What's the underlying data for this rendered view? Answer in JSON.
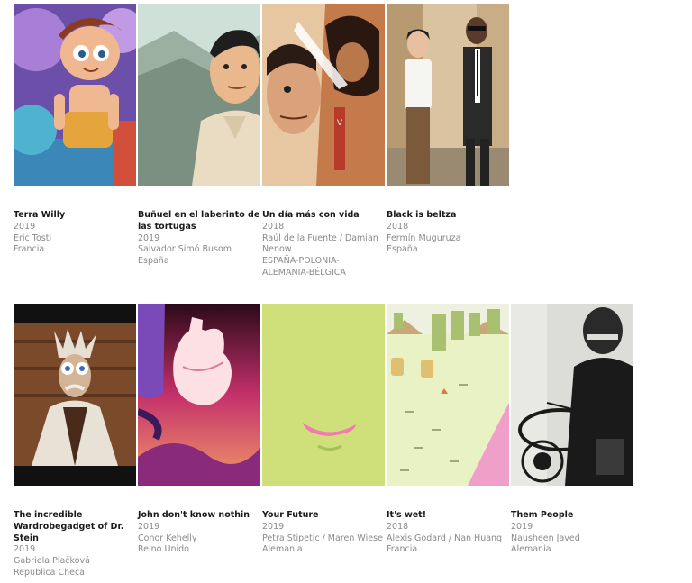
{
  "films": [
    {
      "title": "Terra Willy",
      "year": "2019",
      "director": "Eric Tosti",
      "country": "Francia"
    },
    {
      "title": "Buñuel en el laberinto de las tortugas",
      "year": "2019",
      "director": "Salvador Simó Busom",
      "country": "España"
    },
    {
      "title": "Un día más con vida",
      "year": "2018",
      "director": "Raúl de la Fuente / Damian Nenow",
      "country": "ESPAÑA-POLONIA-ALEMANIA-BÉLGICA"
    },
    {
      "title": "Black is beltza",
      "year": "2018",
      "director": "Fermín Muguruza",
      "country": "España"
    },
    {
      "title": "The incredible Wardrobegadget of Dr. Stein",
      "year": "2019",
      "director": "Gabriela Plačková",
      "country": "Republica Checa"
    },
    {
      "title": "John don't know nothin",
      "year": "2019",
      "director": "Conor Kehelly",
      "country": "Reino Unido"
    },
    {
      "title": "Your Future",
      "year": "2019",
      "director": "Petra Stipetic / Maren Wiese",
      "country": "Alemania"
    },
    {
      "title": "It's wet!",
      "year": "2018",
      "director": "Alexis Godard / Nan Huang",
      "country": "Francia"
    },
    {
      "title": "Them People",
      "year": "2019",
      "director": "Nausheen Javed",
      "country": "Alemania"
    }
  ]
}
